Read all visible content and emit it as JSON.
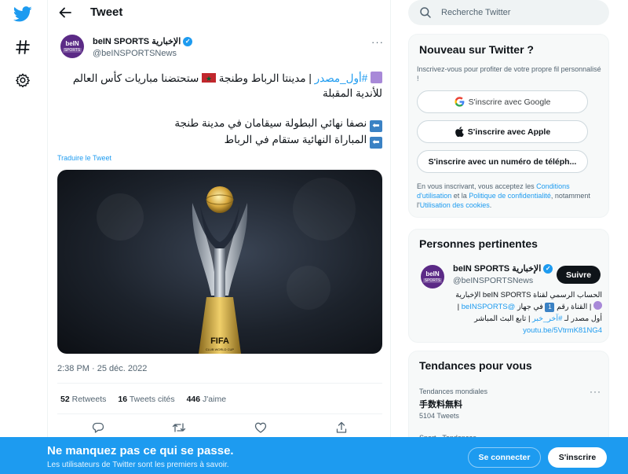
{
  "header": {
    "title": "Tweet"
  },
  "tweet": {
    "author_name": "beIN SPORTS الإخبارية",
    "author_handle": "@beINSPORTSNews",
    "avatar_text": "beIN",
    "avatar_sub": "SPORTS",
    "line1_hashtag": "#أول_مصدر",
    "line1_text": " | مدينتا الرباط وطنجة ",
    "line1_text_b": " ستحتضنا مباريات كأس العالم",
    "line2_text": "للأندية المقبلة",
    "line3_text": "نصفا نهائي البطولة سيقامان في مدينة طنجة",
    "line4_text": "المباراة النهائية ستقام في الرباط",
    "arrow_glyph": "⬅",
    "translate": "Traduire le Tweet",
    "timestamp": "2:38 PM · 25 déc. 2022",
    "retweets_count": "52",
    "retweets_label": "Retweets",
    "quotes_count": "16",
    "quotes_label": "Tweets cités",
    "likes_count": "446",
    "likes_label": "J'aime",
    "media_caption": "FIFA",
    "media_caption_sub": "CLUB WORLD CUP"
  },
  "search": {
    "placeholder": "Recherche Twitter"
  },
  "new_to_twitter": {
    "title": "Nouveau sur Twitter ?",
    "subtitle": "Inscrivez-vous pour profiter de votre propre fil personnalisé !",
    "google_label": "S'inscrire avec Google",
    "apple_label": "S'inscrire avec Apple",
    "phone_label": "S'inscrire avec un numéro de téléph...",
    "legal_a": "En vous inscrivant, vous acceptez les ",
    "legal_terms": "Conditions d'utilisation",
    "legal_b": " et la ",
    "legal_privacy": "Politique de confidentialité",
    "legal_c": ", notamment l'",
    "legal_cookies": "Utilisation des cookies",
    "legal_d": "."
  },
  "relevant": {
    "title": "Personnes pertinentes",
    "name": "beIN SPORTS الإخبارية",
    "handle": "@beINSPORTSNews",
    "follow_label": "Suivre",
    "bio_line1": "الحساب الرسمي لقناة beIN SPORTS الإخبارية",
    "bio_line2a": " | القناة رقم ",
    "bio_num": "1",
    "bio_line2b": " في جهاز ",
    "bio_mention": "@beINSPORTS",
    "bio_line2c": " |",
    "bio_line3a": "أول مصدر لـ ",
    "bio_hashtag": "#آخر_خبر",
    "bio_line3b": " | تابع البث المباشر",
    "bio_link": "youtu.be/5VtrmK81NG4"
  },
  "trends": {
    "title": "Tendances pour vous",
    "item1_context": "Tendances mondiales",
    "item1_name": "手数料無料",
    "item1_count": "5104 Tweets",
    "item2_context": "Sport · Tendances"
  },
  "banner": {
    "title": "Ne manquez pas ce qui se passe.",
    "subtitle": "Les utilisateurs de Twitter sont les premiers à savoir.",
    "login_label": "Se connecter",
    "signup_label": "S'inscrire"
  },
  "colors": {
    "accent": "#1d9bf0",
    "text": "#0f1419",
    "muted": "#536471"
  }
}
